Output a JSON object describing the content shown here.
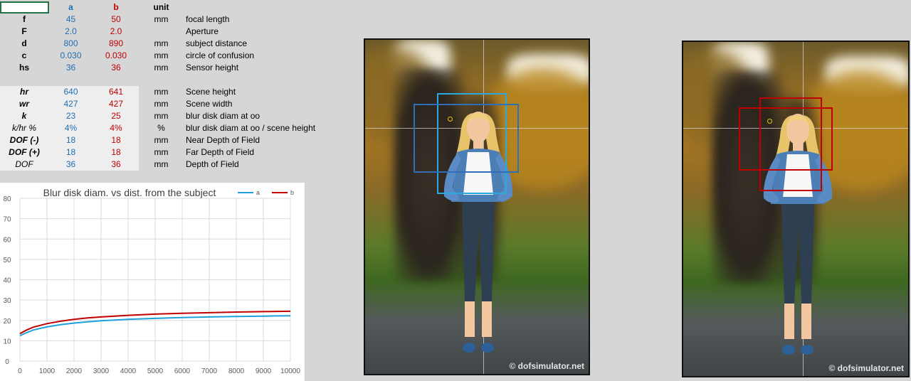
{
  "table": {
    "headers": {
      "a": "a",
      "b": "b",
      "unit": "unit"
    },
    "rows": [
      {
        "key": "f",
        "a": "45",
        "b": "50",
        "unit": "mm",
        "desc": "focal length",
        "style": "bold"
      },
      {
        "key": "F",
        "a": "2.0",
        "b": "2.0",
        "unit": "",
        "desc": "Aperture",
        "style": "bold"
      },
      {
        "key": "d",
        "a": "800",
        "b": "890",
        "unit": "mm",
        "desc": "subject distance",
        "style": "bold"
      },
      {
        "key": "c",
        "a": "0.030",
        "b": "0.030",
        "unit": "mm",
        "desc": "circle of confusion",
        "style": "bold"
      },
      {
        "key": "hs",
        "a": "36",
        "b": "36",
        "unit": "mm",
        "desc": "Sensor height",
        "style": "bold"
      },
      {
        "key": "hr",
        "a": "640",
        "b": "641",
        "unit": "mm",
        "desc": "Scene height",
        "style": "bold-italic"
      },
      {
        "key": "wr",
        "a": "427",
        "b": "427",
        "unit": "mm",
        "desc": "Scene width",
        "style": "bold-italic"
      },
      {
        "key": "k",
        "a": "23",
        "b": "25",
        "unit": "mm",
        "desc": "blur disk diam at oo",
        "style": "bold-italic"
      },
      {
        "key": "k/hr %",
        "a": "4%",
        "b": "4%",
        "unit": "%",
        "desc": "blur disk diam at oo / scene height",
        "style": "italic"
      },
      {
        "key": "DOF (-)",
        "a": "18",
        "b": "18",
        "unit": "mm",
        "desc": "Near Depth of Field",
        "style": "bold-italic"
      },
      {
        "key": "DOF (+)",
        "a": "18",
        "b": "18",
        "unit": "mm",
        "desc": "Far Depth of Field",
        "style": "bold-italic"
      },
      {
        "key": "DOF",
        "a": "36",
        "b": "36",
        "unit": "mm",
        "desc": "Depth of Field",
        "style": "italic"
      }
    ]
  },
  "chart_data": {
    "type": "line",
    "title": "Blur disk diam. vs dist. from the subject",
    "xlabel": "",
    "ylabel": "",
    "xlim": [
      0,
      10000
    ],
    "ylim": [
      0,
      80
    ],
    "x_ticks": [
      0,
      1000,
      2000,
      3000,
      4000,
      5000,
      6000,
      7000,
      8000,
      9000,
      10000
    ],
    "y_ticks": [
      0,
      10,
      20,
      30,
      40,
      50,
      60,
      70,
      80
    ],
    "grid": true,
    "legend_position": "top-right",
    "x": [
      0,
      250,
      500,
      1000,
      1500,
      2000,
      2500,
      3000,
      4000,
      5000,
      6000,
      7000,
      8000,
      9000,
      10000
    ],
    "series": [
      {
        "name": "a",
        "color": "#1ea0dc",
        "values": [
          12.5,
          14.0,
          15.3,
          16.8,
          17.9,
          18.7,
          19.3,
          19.8,
          20.5,
          21.0,
          21.4,
          21.7,
          21.9,
          22.1,
          22.3
        ]
      },
      {
        "name": "b",
        "color": "#c00000",
        "values": [
          13.5,
          15.3,
          16.7,
          18.4,
          19.6,
          20.5,
          21.2,
          21.7,
          22.5,
          23.1,
          23.5,
          23.8,
          24.1,
          24.3,
          24.5
        ]
      }
    ]
  },
  "photos": {
    "watermark": "© dofsimulator.net",
    "frame_colors": {
      "a": "#1ea0dc",
      "b": "#c00000"
    }
  }
}
